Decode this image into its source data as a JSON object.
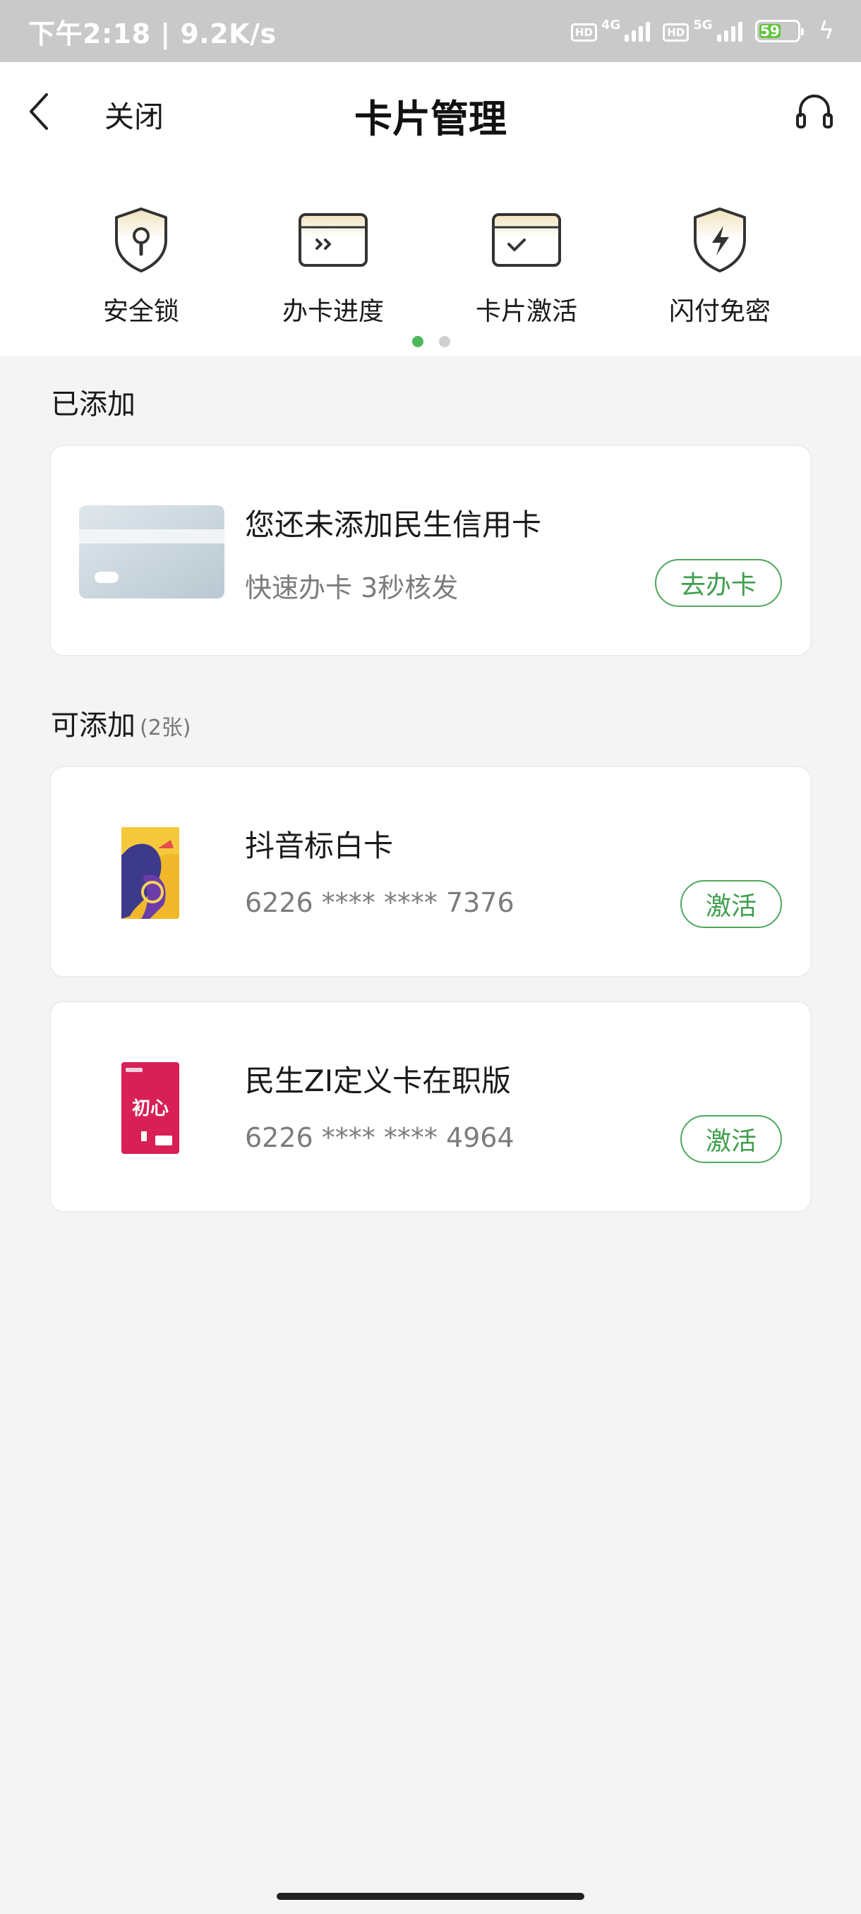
{
  "status_bar": {
    "time_speed": "下午2:18 | 9.2K/s",
    "hd_label": "HD",
    "net1": "4G",
    "net2": "5G",
    "battery": "59"
  },
  "nav": {
    "close_label": "关闭",
    "title": "卡片管理"
  },
  "quick_actions": [
    {
      "label": "安全锁",
      "icon": "shield-lock-icon"
    },
    {
      "label": "办卡进度",
      "icon": "card-progress-icon"
    },
    {
      "label": "卡片激活",
      "icon": "card-activate-icon"
    },
    {
      "label": "闪付免密",
      "icon": "shield-lightning-icon"
    }
  ],
  "added": {
    "section_title": "已添加",
    "card": {
      "title": "您还未添加民生信用卡",
      "subtitle": "快速办卡 3秒核发",
      "button": "去办卡"
    }
  },
  "available": {
    "section_title": "可添加",
    "count": "(2张)",
    "cards": [
      {
        "name": "抖音标白卡",
        "number": "6226 **** **** 7376",
        "button": "激活"
      },
      {
        "name": "民生ZI定义卡在职版",
        "number": "6226 **** **** 4964",
        "button": "激活",
        "card_art_text": "初心"
      }
    ]
  },
  "colors": {
    "accent": "#4fa75c",
    "background": "#f4f4f4"
  }
}
